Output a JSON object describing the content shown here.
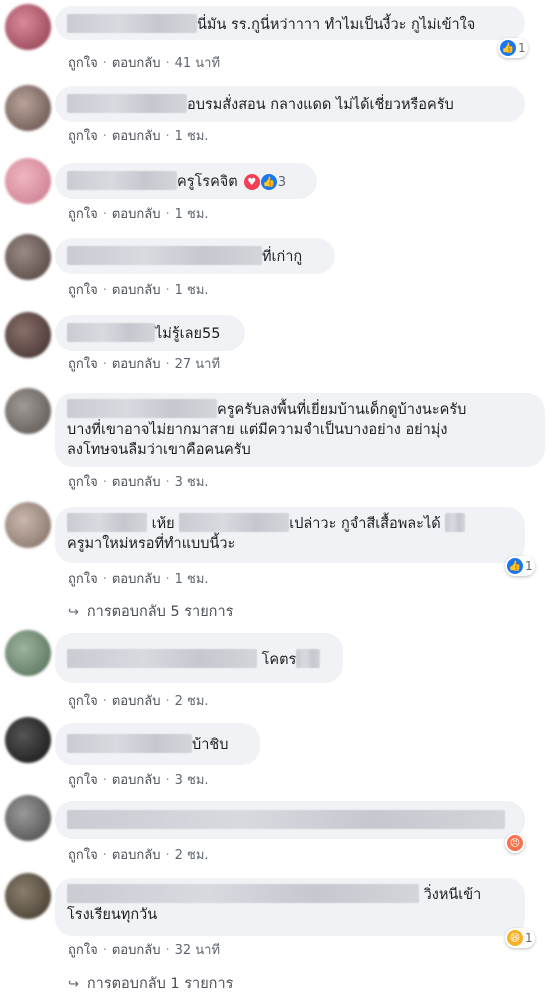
{
  "actions": {
    "like": "ถูกใจ",
    "reply": "ตอบกลับ"
  },
  "comments": [
    {
      "text": "นี่มัน รร.กูนี่หว่าาาา ทำไมเป็นงี้วะ กูไม่เข้าใจ",
      "time": "41 นาที",
      "reactions": {
        "count": "1",
        "types": [
          "like-icon"
        ]
      }
    },
    {
      "text": "อบรมสั่งสอน กลางแดด ไม่ได้เชี่ยวหรือครับ",
      "time": "1 ชม."
    },
    {
      "text": "ครูโรคจิต",
      "time": "1 ชม.",
      "reactions": {
        "count": "3",
        "types": [
          "love-icon",
          "like-icon"
        ]
      }
    },
    {
      "text": "ที่เก่ากู",
      "time": "1 ชม."
    },
    {
      "text": "ไม่รู้เลย55",
      "time": "27 นาที"
    },
    {
      "text_lines": [
        "ครูครับลงพื้นที่เยี่ยมบ้านเด็กดูบ้างนะครับ",
        "บางที่เขาอาจไม่ยากมาสาย แต่มีความจำเป็นบางอย่าง อย่ามุ่ง",
        "ลงโทษจนลืมว่าเขาคือคนครับ"
      ],
      "time": "3 ชม."
    },
    {
      "text_a": "เห้ย",
      "text_b": "เปล่าวะ กูจำสีเสื้อพละได้",
      "text_line2": "ครูมาใหม่หรอที่ทำแบบนี้วะ",
      "time": "1 ชม.",
      "reactions": {
        "count": "1",
        "types": [
          "like-icon"
        ]
      },
      "replies": "การตอบกลับ 5 รายการ"
    },
    {
      "text": "โคตร",
      "time": "2 ชม."
    },
    {
      "text": "บ้าชิบ",
      "time": "3 ชม."
    },
    {
      "text": "",
      "time": "2 ชม.",
      "reactions": {
        "types": [
          "angry-icon"
        ]
      }
    },
    {
      "text": "วิ่งหนีเข้า",
      "text_line2": "โรงเรียนทุกวัน",
      "time": "32 นาที",
      "reactions": {
        "count": "1",
        "types": [
          "haha-icon"
        ]
      },
      "replies": "การตอบกลับ 1 รายการ"
    }
  ],
  "colors": {
    "bubble": "#f0f2f5",
    "like": "#1877f2",
    "love": "#f33e58",
    "angry": "#f7714c",
    "haha": "#f7b125"
  }
}
